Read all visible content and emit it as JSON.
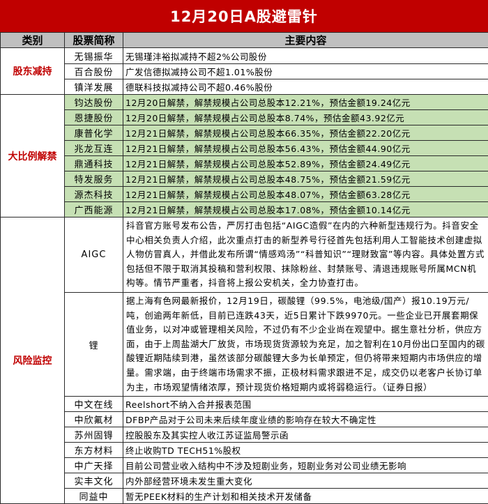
{
  "title": "12月20日A股避雷针",
  "headers": [
    "类别",
    "股票简称",
    "主要内容"
  ],
  "sections": [
    {
      "category": "股东减持",
      "rows": [
        {
          "stock": "无锡振华",
          "content": "无锡瑾沣裕拟减持不超2%公司股份"
        },
        {
          "stock": "百合股份",
          "content": "广发信德拟减持公司不超1.01%股份"
        },
        {
          "stock": "镇洋发展",
          "content": "德联科技拟减持公司不超0.46%股份"
        }
      ]
    },
    {
      "category": "大比例解禁",
      "rows": [
        {
          "stock": "钧达股份",
          "content": "12月20日解禁，解禁规模占公司总股本12.21%，预估金额19.24亿元"
        },
        {
          "stock": "恩捷股份",
          "content": "12月20日解禁，解禁规模占公司总股本8.74%，预估金额43.92亿元"
        },
        {
          "stock": "康普化学",
          "content": "12月21日解禁，解禁规模占公司总股本66.35%，预估金额22.20亿元"
        },
        {
          "stock": "兆龙互连",
          "content": "12月21日解禁，解禁规模占公司总股本56.43%，预估金额44.90亿元"
        },
        {
          "stock": "鼎通科技",
          "content": "12月21日解禁，解禁规模占公司总股本52.89%，预估金额24.49亿元"
        },
        {
          "stock": "特发服务",
          "content": "12月21日解禁，解禁规模占公司总股本48.75%，预估金额21.59亿元"
        },
        {
          "stock": "源杰科技",
          "content": "12月21日解禁，解禁规模占公司总股本48.07%，预估金额63.28亿元"
        },
        {
          "stock": "广西能源",
          "content": "12月21日解禁，解禁规模占公司总股本17.08%，预估金额10.14亿元"
        }
      ]
    },
    {
      "category": "风险监控",
      "rows": [
        {
          "stock": "AIGC",
          "content": "抖音官方账号发布公告，严厉打击包括“AIGC造假”在内的六种新型违规行为。抖音安全中心相关负责人介绍，此次重点打击的新型养号行径首先包括利用人工智能技术创建虚拟人物仿冒真人，并借此发布所谓“情感鸡汤”“科普知识”“理财致富”等内容。具体处置方式包括但不限于取消其投稿和营利权限、抹除粉丝、封禁账号、清退违规账号所属MCN机构等。情节严重者，抖音将上报公安机关，全力协查打击。"
        },
        {
          "stock": "锂",
          "content": "据上海有色网最新报价，12月19日，碳酸锂（99.5%，电池级/国产）报10.19万元/吨，创逾两年新低，目前已连跌43天，近5日累计下跌9970元。一些企业已开展套期保值业务，以对冲或管理相关风险，不过仍有不少企业尚在观望中。据生意社分析，供应方面，由于上周盐湖大厂放货，市场现货货源较为充足，加之智利在10月份出口至国内的碳酸锂近期陆续到港，虽然该部分碳酸锂大多为长单预定，但仍将带来短期内市场供应的增量。需求端，由于终端市场需求不振，正极材料需求跟进不足，成交仍以老客户长协订单为主，市场观望情绪浓厚，预计现货价格短期内或将弱稳运行。（证券日报）"
        },
        {
          "stock": "中文在线",
          "content": "Reelshort不纳入合并报表范围"
        },
        {
          "stock": "中欣氟材",
          "content": "DFBP产品对于公司未来后续年度业绩的影响存在较大不确定性"
        },
        {
          "stock": "苏州固锝",
          "content": "控股股东及其实控人收江苏证监局警示函"
        },
        {
          "stock": "东方材料",
          "content": "终止收购TD TECH51%股权"
        },
        {
          "stock": "中广天择",
          "content": "目前公司营业收入结构中不涉及短剧业务，短剧业务对公司业绩无影响"
        },
        {
          "stock": "实丰文化",
          "content": "内外部经营环境未发生重大变化"
        },
        {
          "stock": "同益中",
          "content": "暂无PEEK材料的生产计划和相关技术开发储备"
        }
      ]
    }
  ]
}
